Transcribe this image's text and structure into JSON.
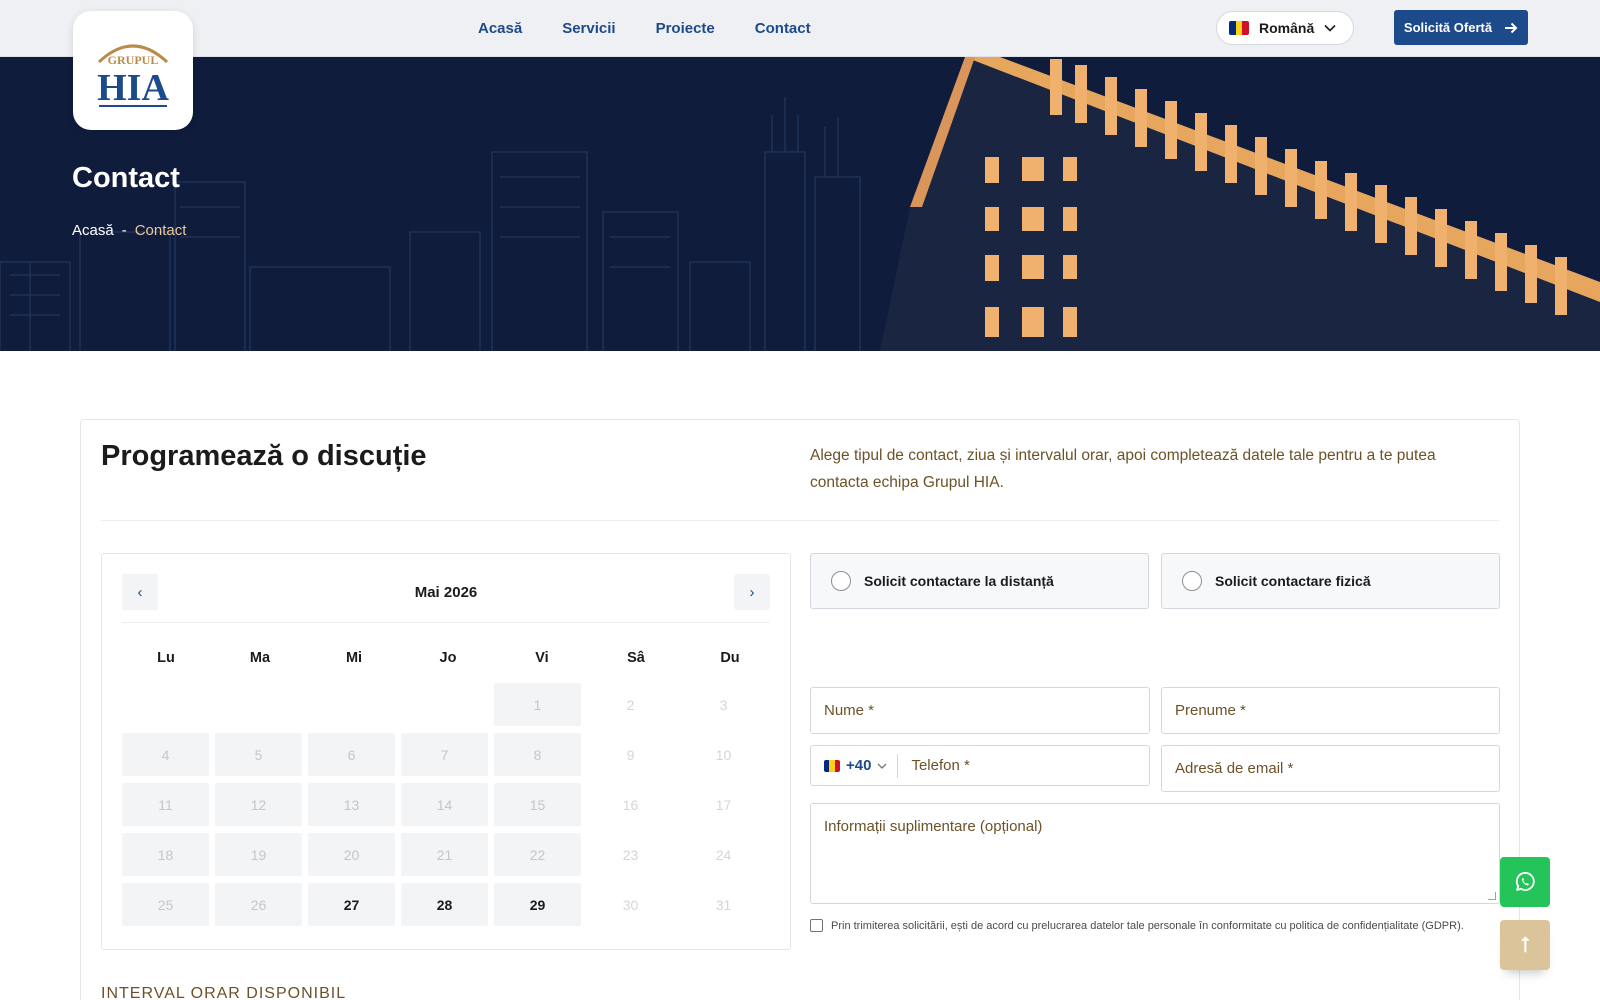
{
  "header": {
    "logo": {
      "top_text": "GRUPUL",
      "main_text": "HIA"
    },
    "nav": [
      "Acasă",
      "Servicii",
      "Proiecte",
      "Contact"
    ],
    "language": "Română",
    "cta_label": "Solicită Ofertă"
  },
  "hero": {
    "title": "Contact",
    "breadcrumb": {
      "home": "Acasă",
      "separator": "-",
      "current": "Contact"
    }
  },
  "main": {
    "title": "Programează o discuție",
    "description": "Alege tipul de contact, ziua și intervalul orar, apoi completează datele tale pentru a te putea contacta echipa Grupul HIA.",
    "calendar": {
      "prev": "‹",
      "next": "›",
      "month": "Mai 2026",
      "weekdays": [
        "Lu",
        "Ma",
        "Mi",
        "Jo",
        "Vi",
        "Sâ",
        "Du"
      ],
      "leading_blanks": 4,
      "days": 31,
      "available_days": [
        27,
        28,
        29
      ]
    },
    "contact_types": [
      "Solicit contactare la distanță",
      "Solicit contactare fizică"
    ],
    "form": {
      "last_name": "Nume *",
      "first_name": "Prenume *",
      "phone_code": "+40",
      "phone": "Telefon *",
      "email": "Adresă de email *",
      "notes": "Informații suplimentare (opțional)",
      "gdpr": "Prin trimiterea solicitării, ești de acord cu prelucrarea datelor tale personale în conformitate cu politica de confidențialitate (GDPR)."
    },
    "interval_heading": "INTERVAL ORAR DISPONIBIL"
  },
  "floating": {
    "scroll_top": "⭡"
  },
  "colors": {
    "brand_blue": "#1d4a8a",
    "hero_bg": "#0f1c3b",
    "gold": "#e9c89a",
    "text_brown": "#6b5228",
    "whatsapp": "#25c45a",
    "flag": [
      "#002b7f",
      "#fcd116",
      "#ce1126"
    ]
  },
  "icons": {
    "logo": "hia-logo-icon",
    "lang_flag": "romania-flag-icon",
    "chevron": "chevron-down-icon",
    "cta_arrow": "arrow-right-icon",
    "whatsapp": "whatsapp-icon",
    "scroll_top": "arrow-up-icon"
  }
}
